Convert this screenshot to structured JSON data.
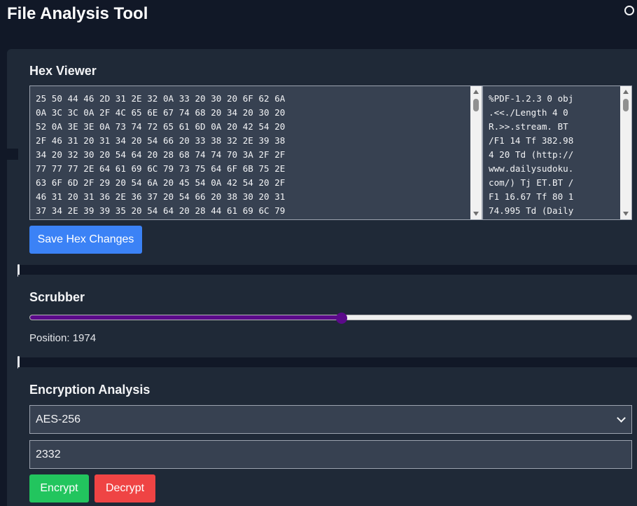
{
  "app": {
    "title": "File Analysis Tool"
  },
  "hex_viewer": {
    "title": "Hex Viewer",
    "hex_text": "25 50 44 46 2D 31 2E 32 0A 33 20 30 20 6F 62 6A\n0A 3C 3C 0A 2F 4C 65 6E 67 74 68 20 34 20 30 20\n52 0A 3E 3E 0A 73 74 72 65 61 6D 0A 20 42 54 20\n2F 46 31 20 31 34 20 54 66 20 33 38 32 2E 39 38\n34 20 32 30 20 54 64 20 28 68 74 74 70 3A 2F 2F\n77 77 77 2E 64 61 69 6C 79 73 75 64 6F 6B 75 2E\n63 6F 6D 2F 29 20 54 6A 20 45 54 0A 42 54 20 2F\n46 31 20 31 36 2E 36 37 20 54 66 20 38 30 20 31\n37 34 2E 39 39 35 20 54 64 20 28 44 61 69 6C 79",
    "ascii_text": "%PDF-1.2.3 0 obj\n.<<./Length 4 0\nR.>>.stream. BT\n/F1 14 Tf 382.98\n4 20 Td (http://\nwww.dailysudoku.\ncom/) Tj ET.BT /\nF1 16.67 Tf 80 1\n74.995 Td (Daily",
    "save_label": "Save Hex Changes"
  },
  "scrubber": {
    "title": "Scrubber",
    "position_text": "Position: 1974",
    "level_fraction": 0.518
  },
  "encryption": {
    "title": "Encryption Analysis",
    "algorithm": "AES-256",
    "key_value": "2332",
    "encrypt_label": "Encrypt",
    "decrypt_label": "Decrypt"
  },
  "colors": {
    "page_bg": "#111827",
    "panel_bg": "#1f2937",
    "input_bg": "#374151",
    "save_button": "#3b82f6",
    "encrypt_button": "#22c55e",
    "decrypt_button": "#ef4444",
    "slider_accent": "#5b0a8a"
  },
  "icons": {
    "theme_toggle": "circle-outline-icon",
    "select_chevron": "chevron-down-icon"
  }
}
